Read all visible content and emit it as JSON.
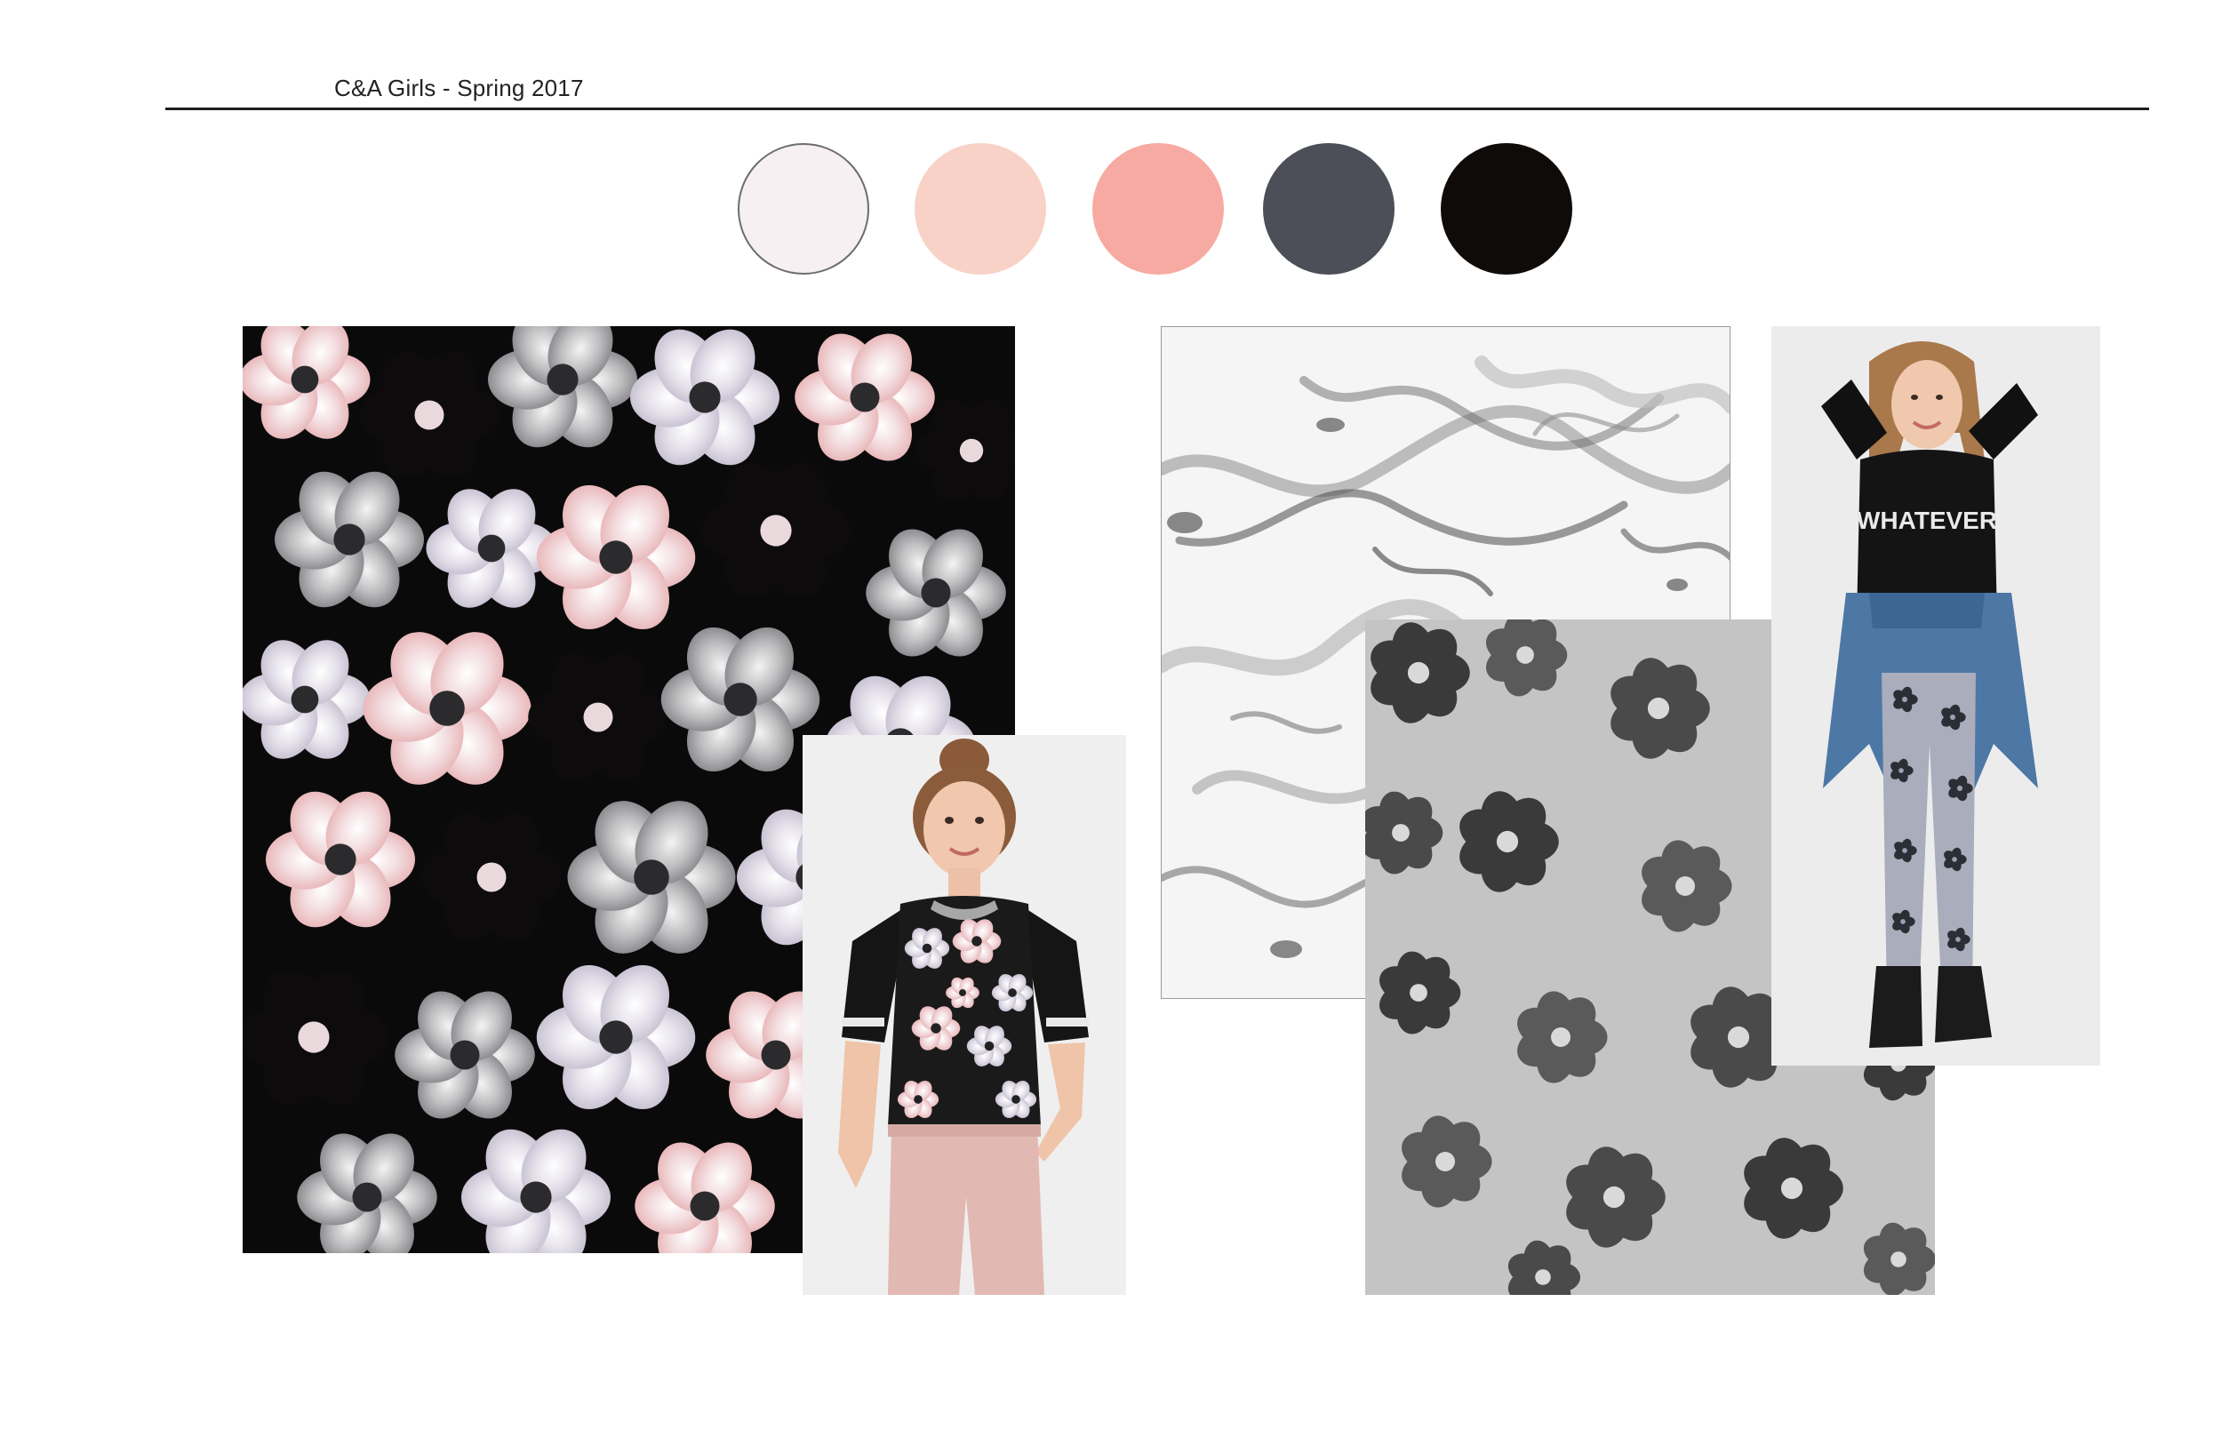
{
  "header": {
    "title": "C&A Girls - Spring 2017"
  },
  "palette": [
    {
      "name": "swatch-off-white",
      "color": "#f6f0f2",
      "outlined": true
    },
    {
      "name": "swatch-blush",
      "color": "#f8d2c6"
    },
    {
      "name": "swatch-coral-pink",
      "color": "#f7aaa1"
    },
    {
      "name": "swatch-charcoal",
      "color": "#4c4e58"
    },
    {
      "name": "swatch-black",
      "color": "#0f0b08"
    }
  ],
  "images": {
    "floral_print": "floral print artwork on black ground",
    "model_tee": "model wearing floral raglan tee",
    "marble_print": "grey marble texture print",
    "grey_floral_print": "grey floral print",
    "model_leggings": "model wearing floral leggings and denim shirt",
    "tee_slogan": "WHATEVER"
  }
}
